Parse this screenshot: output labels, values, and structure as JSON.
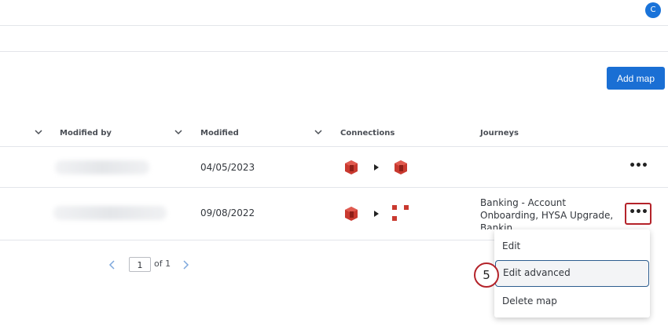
{
  "header": {
    "avatar_initial": "C"
  },
  "toolbar": {
    "add_map_label": "Add map"
  },
  "table": {
    "columns": [
      {
        "label": "Modified by"
      },
      {
        "label": "Modified"
      },
      {
        "label": "Connections"
      },
      {
        "label": "Journeys"
      }
    ],
    "rows": [
      {
        "modified": "04/05/2023",
        "journeys": []
      },
      {
        "modified": "09/08/2022",
        "journeys": [
          "Banking - Account",
          "Onboarding, HYSA Upgrade,",
          "Bankin"
        ]
      }
    ]
  },
  "more_label": "•••",
  "menu": {
    "items": [
      "Edit",
      "Edit advanced",
      "Delete map"
    ]
  },
  "step_badge": "5",
  "pagination": {
    "current": "1",
    "of_label": "of 1"
  },
  "colors": {
    "accent": "#1a6fd4",
    "highlight": "#b4232a",
    "connection_icon": "#c9392f"
  }
}
